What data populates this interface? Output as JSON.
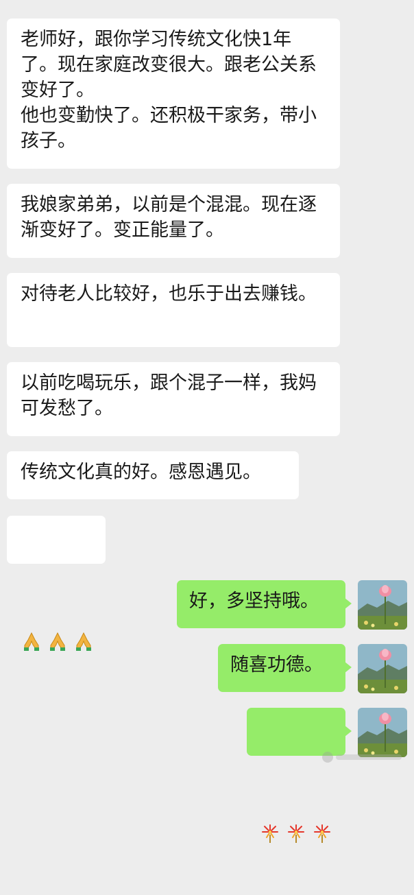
{
  "conversation": {
    "incoming": [
      "老师好，跟你学习传统文化快1年了。现在家庭改变很大。跟老公关系变好了。\n他也变勤快了。还积极干家务，带小孩子。",
      "我娘家弟弟，以前是个混混。现在逐渐变好了。变正能量了。",
      "对待老人比较好，也乐于出去赚钱。",
      "以前吃喝玩乐，跟个混子一样，我妈可发愁了。",
      "传统文化真的好。感恩遇见。"
    ],
    "incoming_emoji_message": {
      "emoji": [
        "folded-hands",
        "folded-hands",
        "folded-hands"
      ]
    },
    "outgoing": [
      "好，多坚持哦。",
      "随喜功德。"
    ],
    "outgoing_emoji_message": {
      "emoji": [
        "fireworks",
        "fireworks",
        "fireworks"
      ]
    }
  },
  "colors": {
    "background": "#ededed",
    "incoming_bubble": "#ffffff",
    "outgoing_bubble": "#95ec69",
    "text": "#191919"
  },
  "icons": {
    "avatar": "lotus-landscape-avatar",
    "incoming_emoji": "folded-hands-icon",
    "outgoing_emoji": "fireworks-icon"
  }
}
